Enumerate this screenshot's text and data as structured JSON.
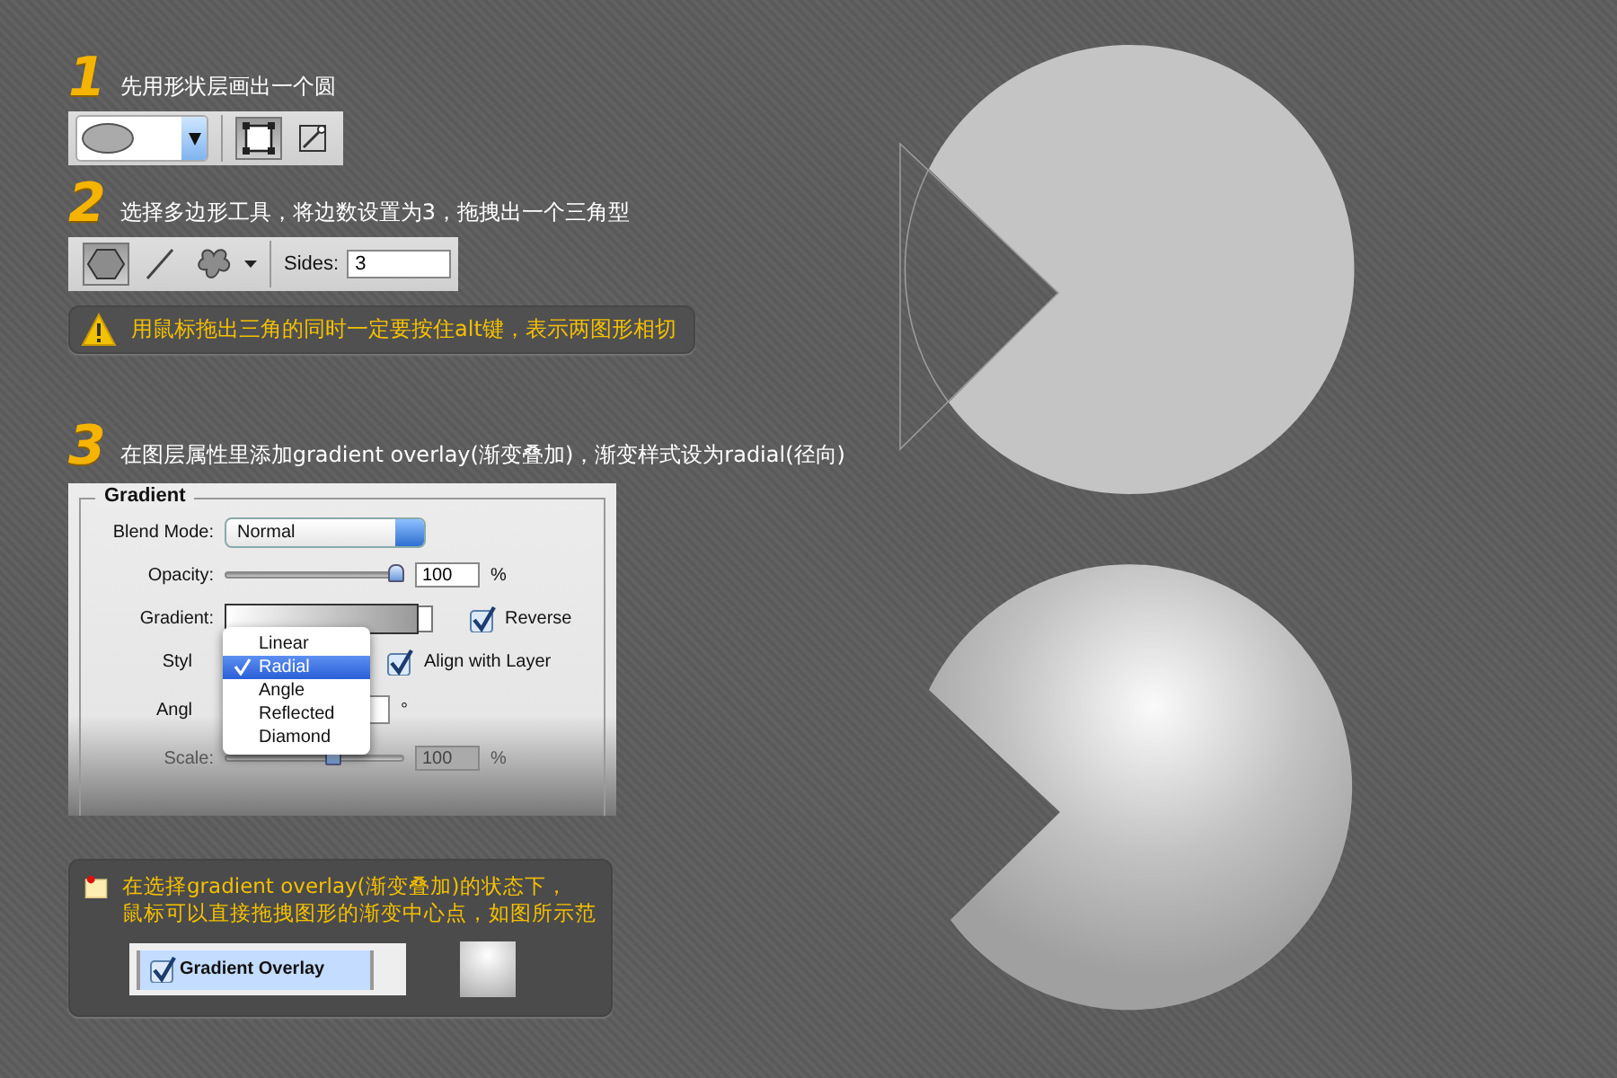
{
  "steps": [
    {
      "number": "1",
      "text": "先用形状层画出一个圆"
    },
    {
      "number": "2",
      "text": "选择多边形工具，将边数设置为3，拖拽出一个三角型"
    },
    {
      "number": "3",
      "text": "在图层属性里添加gradient overlay(渐变叠加)，渐变样式设为radial(径向)"
    }
  ],
  "shape_toolbar": {
    "modes": [
      {
        "kind": "shape_layers",
        "selected": true
      },
      {
        "kind": "paths",
        "selected": false
      }
    ]
  },
  "polygon_toolbar": {
    "tools": [
      {
        "kind": "polygon",
        "selected": true
      },
      {
        "kind": "line",
        "selected": false
      },
      {
        "kind": "custom_shape",
        "selected": false
      }
    ],
    "sides_label": "Sides:",
    "sides_value": "3"
  },
  "warning": "用鼠标拖出三角的同时一定要按住alt键，表示两图形相切",
  "gradient_panel": {
    "title": "Gradient",
    "blend_mode_label": "Blend Mode:",
    "blend_mode": "Normal",
    "opacity_label": "Opacity:",
    "opacity": {
      "level": 1.0
    },
    "opacity_value": "100",
    "opacity_unit": "%",
    "gradient_label": "Gradient:",
    "reverse": {
      "label": "Reverse",
      "checked": true
    },
    "style_label": "Styl",
    "align": {
      "label": "Align with Layer",
      "checked": true
    },
    "angle_label": "Angl",
    "angle_unit": "°",
    "scale_label": "Scale:",
    "scale": {
      "level": 0.62
    },
    "scale_value": "100",
    "scale_unit": "%",
    "style_menu": [
      {
        "label": "Linear",
        "selected": false
      },
      {
        "label": "Radial",
        "selected": true
      },
      {
        "label": "Angle",
        "selected": false
      },
      {
        "label": "Reflected",
        "selected": false
      },
      {
        "label": "Diamond",
        "selected": false
      }
    ]
  },
  "tip": {
    "lines": [
      "在选择gradient overlay(渐变叠加)的状态下，",
      "鼠标可以直接拖拽图形的渐变中心点，如图所示范"
    ],
    "layer_style": {
      "label": "Gradient Overlay",
      "checked": true
    }
  }
}
